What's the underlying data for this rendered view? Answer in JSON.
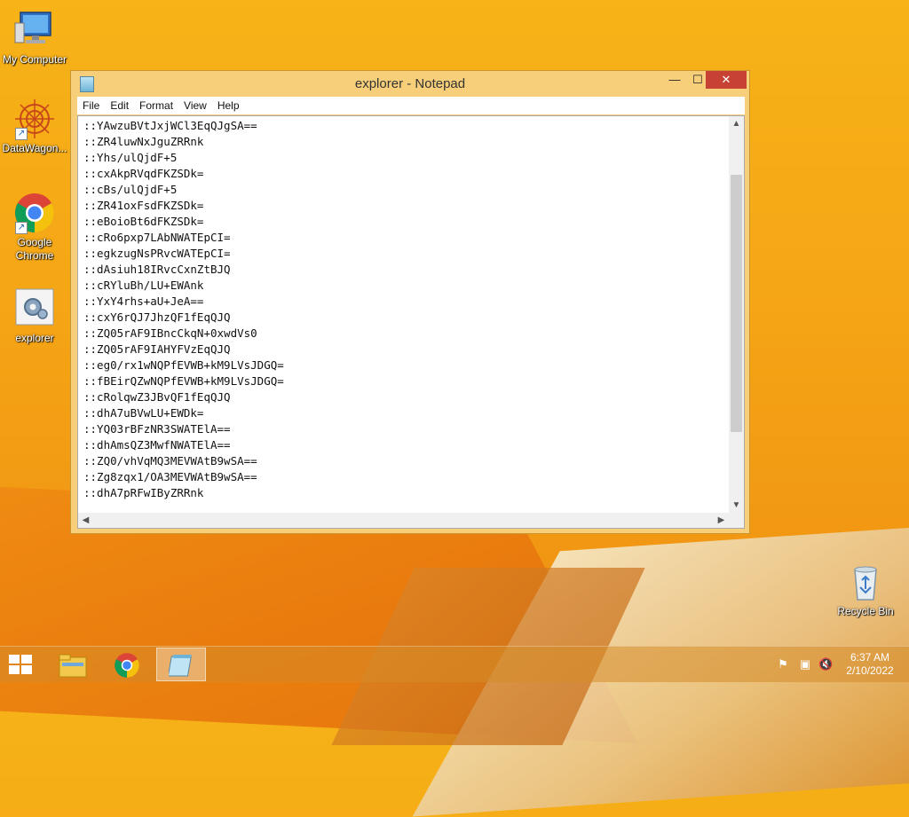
{
  "desktop": {
    "icons": [
      {
        "label": "My Computer"
      },
      {
        "label": "DataWagon..."
      },
      {
        "label": "Google Chrome"
      },
      {
        "label": "explorer"
      }
    ],
    "recycle_bin": {
      "label": "Recycle Bin"
    }
  },
  "window": {
    "title": "explorer - Notepad",
    "controls": {
      "minimize": "—",
      "maximize": "☐",
      "close": "✕"
    },
    "menu": [
      "File",
      "Edit",
      "Format",
      "View",
      "Help"
    ],
    "content_lines": [
      "::YAwzuBVtJxjWCl3EqQJgSA==",
      "::ZR4luwNxJguZRRnk",
      "::Yhs/ulQjdF+5",
      "::cxAkpRVqdFKZSDk=",
      "::cBs/ulQjdF+5",
      "::ZR41oxFsdFKZSDk=",
      "::eBoioBt6dFKZSDk=",
      "::cRo6pxp7LAbNWATEpCI=",
      "::egkzugNsPRvcWATEpCI=",
      "::dAsiuh18IRvcCxnZtBJQ",
      "::cRYluBh/LU+EWAnk",
      "::YxY4rhs+aU+JeA==",
      "::cxY6rQJ7JhzQF1fEqQJQ",
      "::ZQ05rAF9IBncCkqN+0xwdVs0",
      "::ZQ05rAF9IAHYFVzEqQJQ",
      "::eg0/rx1wNQPfEVWB+kM9LVsJDGQ=",
      "::fBEirQZwNQPfEVWB+kM9LVsJDGQ=",
      "::cRolqwZ3JBvQF1fEqQJQ",
      "::dhA7uBVwLU+EWDk=",
      "::YQ03rBFzNR3SWATElA==",
      "::dhAmsQZ3MwfNWATElA==",
      "::ZQ0/vhVqMQ3MEVWAtB9wSA==",
      "::Zg8zqx1/OA3MEVWAtB9wSA==",
      "::dhA7pRFwIByZRRnk"
    ],
    "scroll_arrows": {
      "up": "▲",
      "down": "▼",
      "left": "◀",
      "right": "▶"
    }
  },
  "taskbar": {
    "clock": {
      "time": "6:37 AM",
      "date": "2/10/2022"
    },
    "tray_icons": [
      "flag-icon",
      "network-icon",
      "volume-muted-icon"
    ]
  },
  "colors": {
    "accent": "#f5a515",
    "close_button": "#c74235",
    "window_frame": "#f7cf7a"
  }
}
